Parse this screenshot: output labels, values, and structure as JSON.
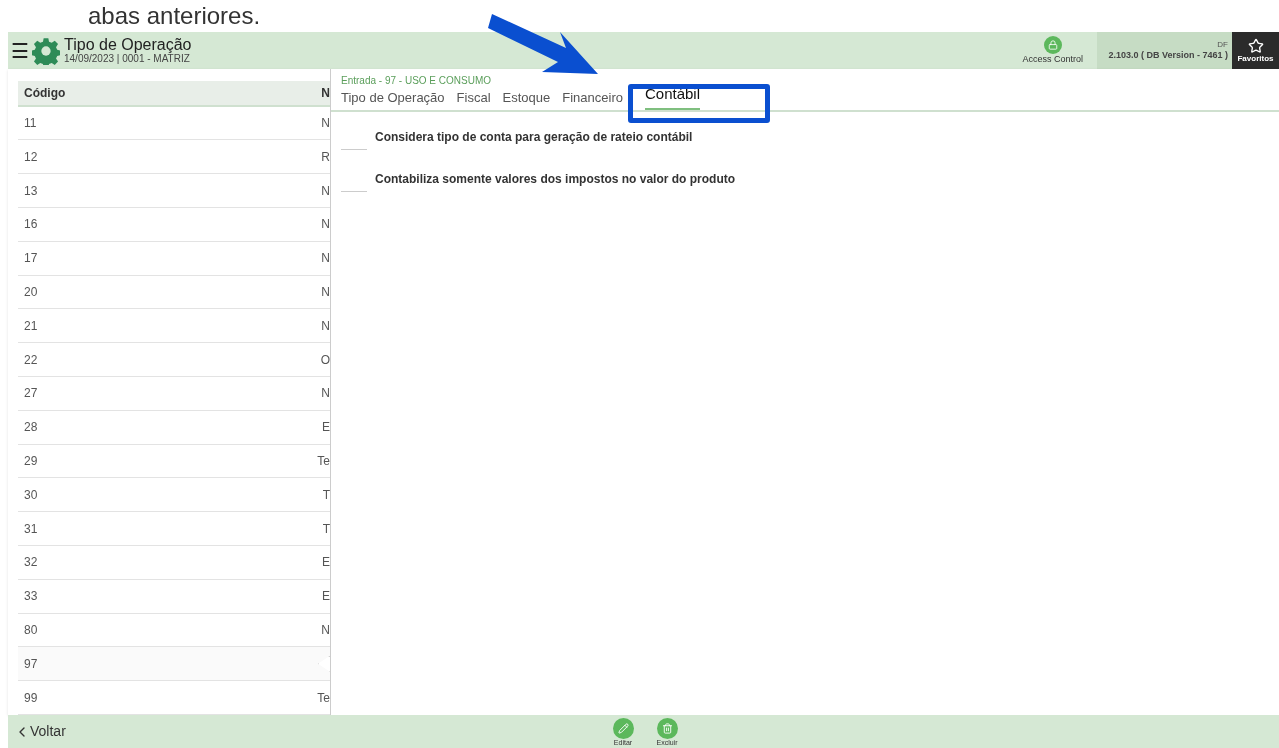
{
  "caption": "abas anteriores.",
  "header": {
    "menu_icon": "☰",
    "title": "Tipo de Operação",
    "subtitle": "14/09/2023 | 0001 - MATRIZ",
    "access_control": "Access Control",
    "env": "DF",
    "version": "2.103.0 ( DB Version - 7461 )",
    "favorites": "Favoritos"
  },
  "list": {
    "columns": [
      "Código",
      "N"
    ],
    "rows": [
      {
        "code": "11",
        "column_2": "N",
        "selected": false
      },
      {
        "code": "12",
        "column_2": "R",
        "selected": false
      },
      {
        "code": "13",
        "column_2": "N",
        "selected": false
      },
      {
        "code": "16",
        "column_2": "N",
        "selected": false
      },
      {
        "code": "17",
        "column_2": "N",
        "selected": false
      },
      {
        "code": "20",
        "column_2": "N",
        "selected": false
      },
      {
        "code": "21",
        "column_2": "N",
        "selected": false
      },
      {
        "code": "22",
        "column_2": "O",
        "selected": false
      },
      {
        "code": "27",
        "column_2": "N",
        "selected": false
      },
      {
        "code": "28",
        "column_2": "E",
        "selected": false
      },
      {
        "code": "29",
        "column_2": "Te",
        "selected": false
      },
      {
        "code": "30",
        "column_2": "T",
        "selected": false
      },
      {
        "code": "31",
        "column_2": "T",
        "selected": false
      },
      {
        "code": "32",
        "column_2": "E",
        "selected": false
      },
      {
        "code": "33",
        "column_2": "E",
        "selected": false
      },
      {
        "code": "80",
        "column_2": "N",
        "selected": false
      },
      {
        "code": "97",
        "selected": true
      },
      {
        "code": "99",
        "column_2": "Te",
        "selected": false
      }
    ]
  },
  "detail": {
    "breadcrumb": "Entrada - 97 - USO E CONSUMO",
    "tabs": [
      {
        "label": "Tipo de Operação",
        "selected": false
      },
      {
        "label": "Fiscal",
        "selected": false
      },
      {
        "label": "Estoque",
        "selected": false
      },
      {
        "label": "Financeiro",
        "selected": false
      },
      {
        "label": "Contábil",
        "selected": true
      }
    ],
    "options": [
      {
        "label": "Considera tipo de conta para geração de rateio contábil",
        "checked": false
      },
      {
        "label": "Contabiliza somente valores dos impostos no valor do produto",
        "checked": false
      }
    ]
  },
  "footer": {
    "back": "Voltar",
    "actions": [
      "Editar",
      "Excluir"
    ]
  }
}
